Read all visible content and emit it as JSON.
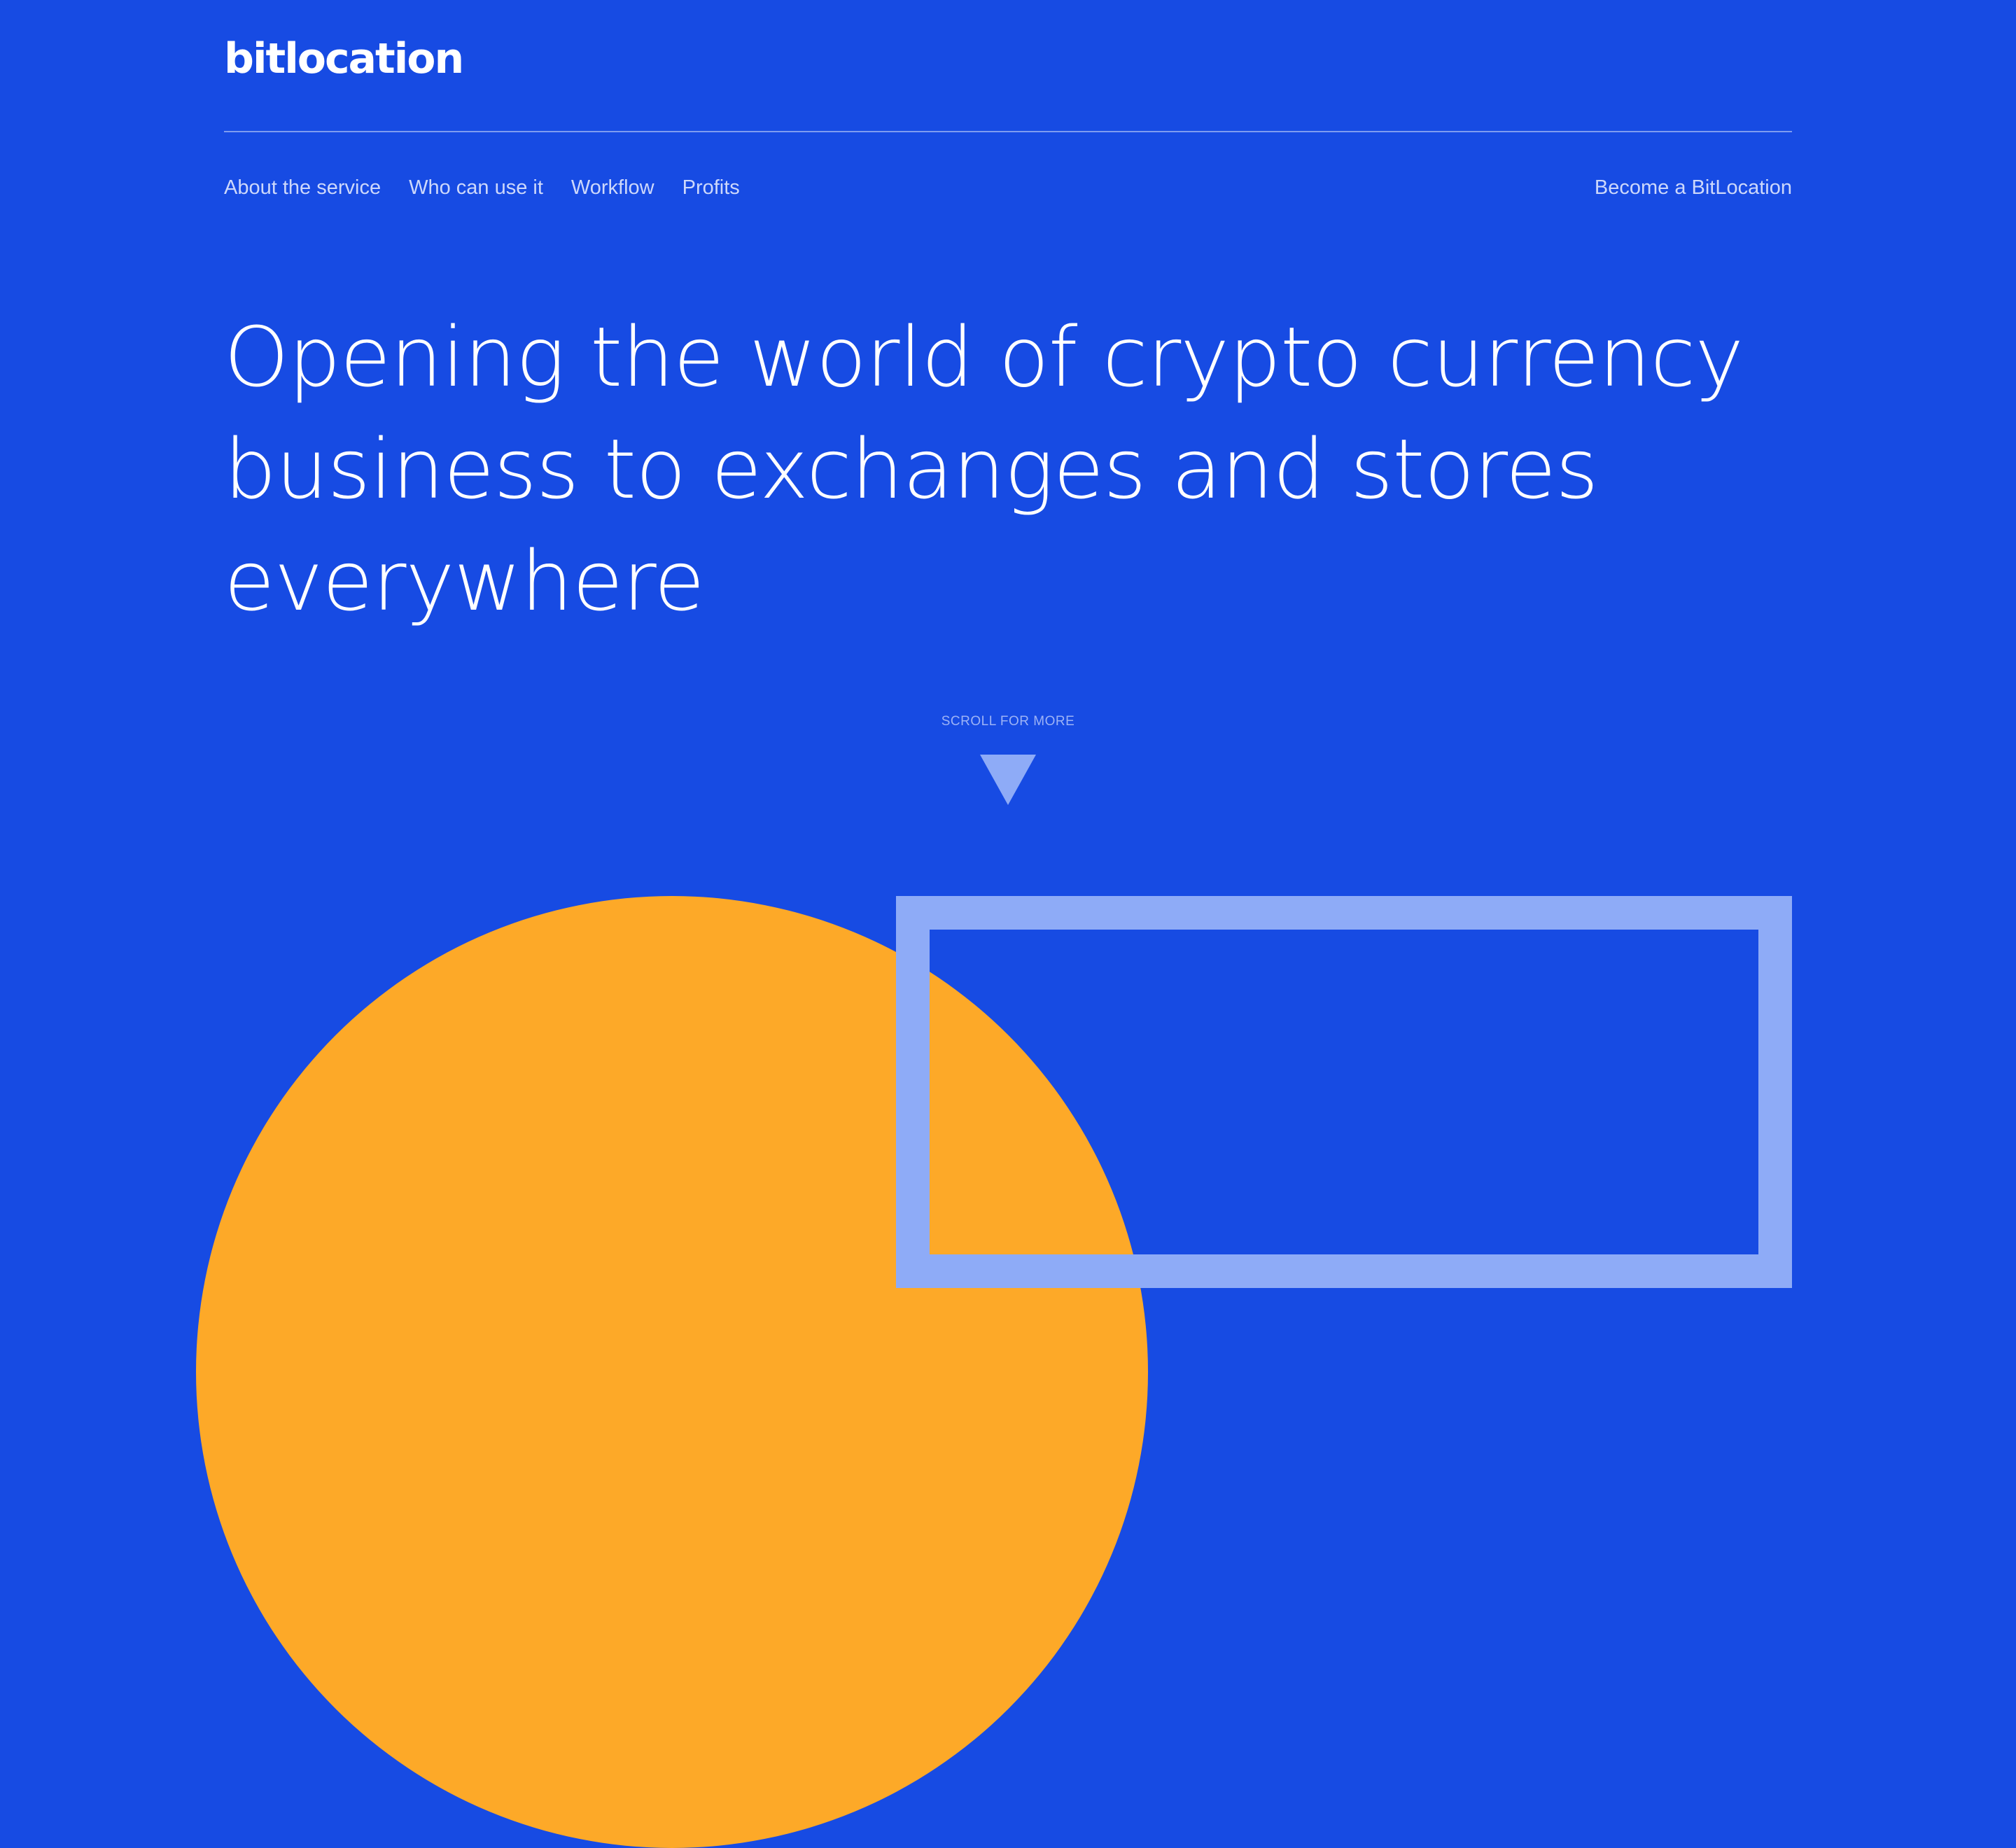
{
  "brand": {
    "logo_text": "bitlocation"
  },
  "nav": {
    "items": [
      {
        "label": "About the service"
      },
      {
        "label": "Who can use it"
      },
      {
        "label": "Workflow"
      },
      {
        "label": "Profits"
      }
    ],
    "cta_label": "Become a BitLocation"
  },
  "hero": {
    "title": "Opening the world of crypto currency business to exchanges and stores everywhere"
  },
  "scroll": {
    "label": "SCROLL FOR MORE",
    "icon": "triangle-down-icon"
  },
  "colors": {
    "background": "#174be3",
    "accent_orange": "#fda928",
    "accent_light_blue": "#8eabf7",
    "text": "#ffffff",
    "nav_text": "#cdd8fb"
  }
}
